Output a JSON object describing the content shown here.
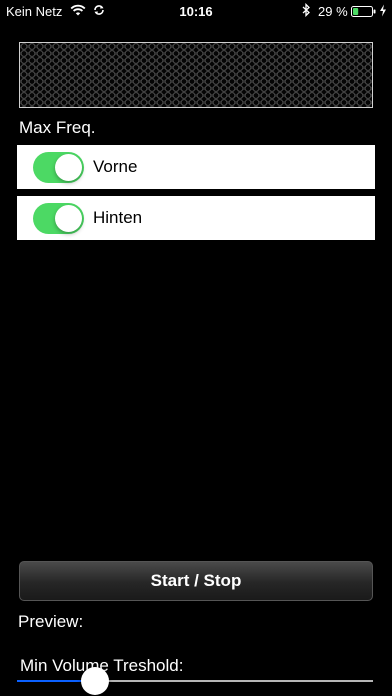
{
  "status_bar": {
    "carrier": "Kein Netz",
    "time": "10:16",
    "battery_percent": "29 %",
    "battery_level": 0.29,
    "icons": [
      "wifi-icon",
      "sync-icon",
      "bluetooth-icon",
      "battery-icon",
      "charging-icon"
    ]
  },
  "main": {
    "max_freq_label": "Max Freq.",
    "switches": [
      {
        "label": "Vorne",
        "on": true
      },
      {
        "label": "Hinten",
        "on": true
      }
    ],
    "start_stop_label": "Start / Stop",
    "preview_label": "Preview:",
    "min_volume_label": "Min Volume Treshold:",
    "min_volume_value": 0.22
  },
  "colors": {
    "background": "#000000",
    "switch_on": "#4cd964",
    "slider_fill": "#0a60ff"
  }
}
